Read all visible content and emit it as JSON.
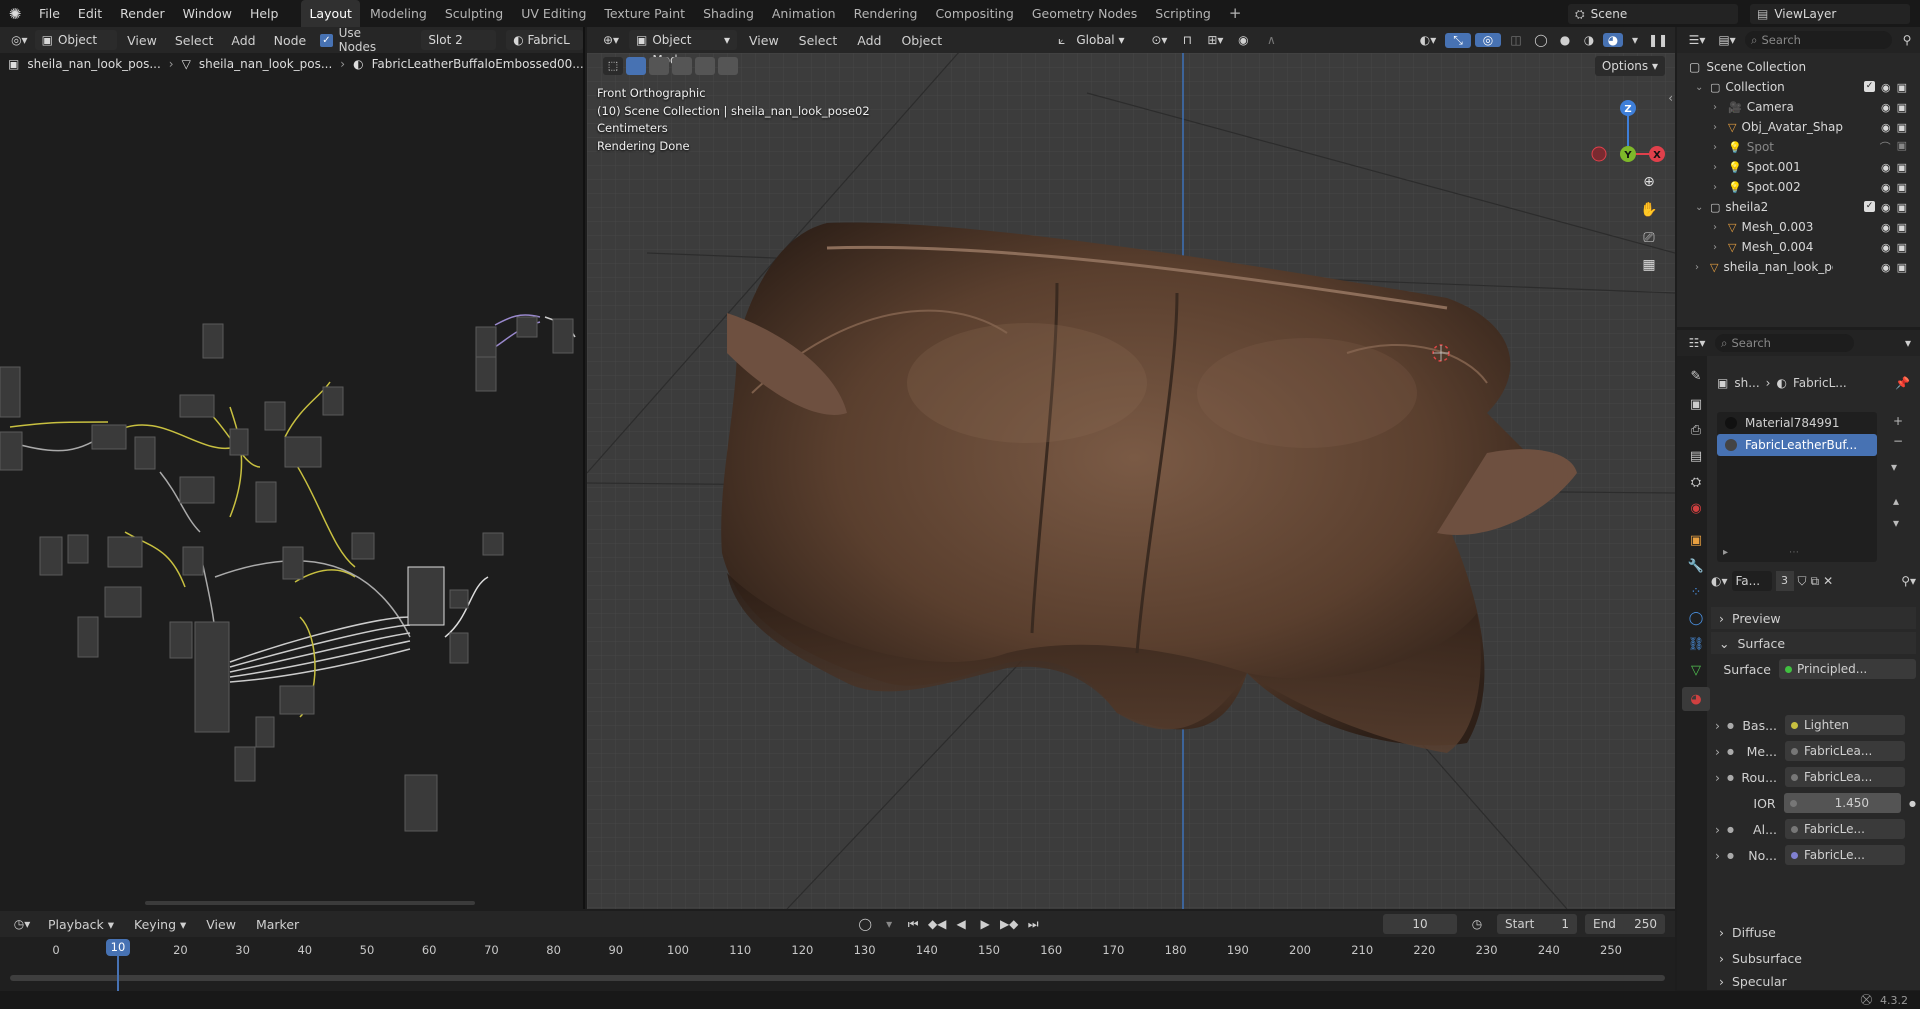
{
  "topbar": {
    "menus": [
      "File",
      "Edit",
      "Render",
      "Window",
      "Help"
    ],
    "workspaces": [
      "Layout",
      "Modeling",
      "Sculpting",
      "UV Editing",
      "Texture Paint",
      "Shading",
      "Animation",
      "Rendering",
      "Compositing",
      "Geometry Nodes",
      "Scripting"
    ],
    "active_workspace": "Layout",
    "add_tab": "+",
    "scene": "Scene",
    "view_layer": "ViewLayer"
  },
  "node_editor": {
    "object_mode": "Object",
    "menus": [
      "View",
      "Select",
      "Add",
      "Node"
    ],
    "use_nodes_label": "Use Nodes",
    "slot": "Slot 2",
    "material_short": "FabricL",
    "breadcrumb": [
      "sheila_nan_look_pos...",
      "sheila_nan_look_pos...",
      "FabricLeatherBuffaloEmbossed00..."
    ]
  },
  "viewport": {
    "mode": "Object Mode",
    "menus": [
      "View",
      "Select",
      "Add",
      "Object"
    ],
    "orientation": "Global",
    "options_label": "Options",
    "overlay_lines": [
      "Front Orthographic",
      "(10) Scene Collection | sheila_nan_look_pose02",
      "Centimeters",
      "Rendering Done"
    ],
    "gizmo": {
      "x": "X",
      "y": "Y",
      "z": "Z"
    }
  },
  "outliner": {
    "search_placeholder": "Search",
    "root": "Scene Collection",
    "items": [
      {
        "label": "Collection",
        "depth": 0,
        "kind": "collection"
      },
      {
        "label": "Camera",
        "depth": 1,
        "kind": "camera"
      },
      {
        "label": "Obj_Avatar_Shap",
        "depth": 1,
        "kind": "object"
      },
      {
        "label": "Spot",
        "depth": 1,
        "kind": "light",
        "dim": true
      },
      {
        "label": "Spot.001",
        "depth": 1,
        "kind": "light"
      },
      {
        "label": "Spot.002",
        "depth": 1,
        "kind": "light"
      },
      {
        "label": "sheila2",
        "depth": 0,
        "kind": "collection"
      },
      {
        "label": "Mesh_0.003",
        "depth": 1,
        "kind": "mesh"
      },
      {
        "label": "Mesh_0.004",
        "depth": 1,
        "kind": "mesh"
      },
      {
        "label": "sheila_nan_look_pos",
        "depth": 0,
        "kind": "object"
      }
    ]
  },
  "properties": {
    "search_placeholder": "Search",
    "breadcrumb_obj": "sh...",
    "breadcrumb_mat": "FabricL...",
    "slots": [
      "Material784991",
      "FabricLeatherBuf..."
    ],
    "material_name": "Fa...",
    "user_count": "3",
    "sections": {
      "preview": "Preview",
      "surface": "Surface",
      "diffuse": "Diffuse",
      "subsurface": "Subsurface",
      "specular": "Specular"
    },
    "surface_label": "Surface",
    "surface_value": "Principled...",
    "inputs": [
      {
        "label": "Bas...",
        "value": "Lighten"
      },
      {
        "label": "Me...",
        "value": "FabricLea..."
      },
      {
        "label": "Rou...",
        "value": "FabricLea..."
      },
      {
        "label": "IOR",
        "value": "1.450"
      },
      {
        "label": "Al...",
        "value": "FabricLe..."
      },
      {
        "label": "No...",
        "value": "FabricLe..."
      }
    ]
  },
  "timeline": {
    "menus": [
      "Playback",
      "Keying",
      "View",
      "Marker"
    ],
    "current_frame": "10",
    "start_label": "Start",
    "start": "1",
    "end_label": "End",
    "end": "250",
    "ticks": [
      "0",
      "10",
      "20",
      "30",
      "40",
      "50",
      "60",
      "70",
      "80",
      "90",
      "100",
      "110",
      "120",
      "130",
      "140",
      "150",
      "160",
      "170",
      "180",
      "190",
      "200",
      "210",
      "220",
      "230",
      "240",
      "250"
    ]
  },
  "status": {
    "version": "4.3.2"
  },
  "colors": {
    "accent": "#4772b3",
    "active_tab": "#303030",
    "x_axis": "#e0404b",
    "y_axis": "#7eb82a",
    "z_axis": "#3e7fd9",
    "leather": "#6b4a36"
  }
}
